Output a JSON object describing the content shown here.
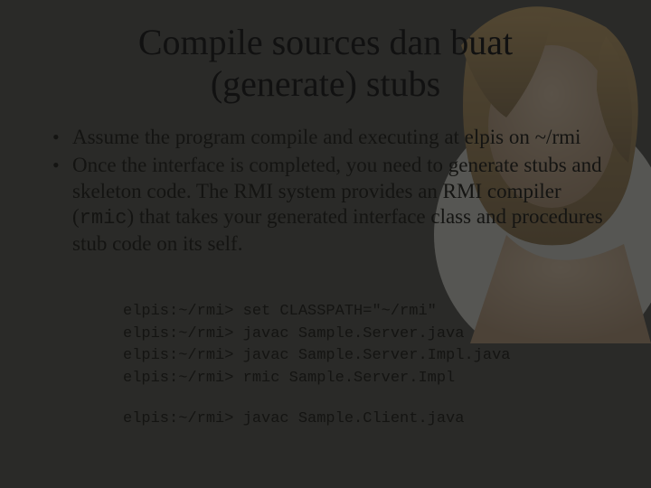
{
  "title_line1": "Compile sources dan buat",
  "title_line2": "(generate) stubs",
  "bullet1": "Assume the program compile and executing at elpis on ~/rmi",
  "bullet2_pre": "Once the interface is completed, you need to generate stubs and skeleton code. The RMI system provides an RMI compiler (",
  "bullet2_code": "rmic",
  "bullet2_post": ") that takes your generated interface class and procedures stub code on its self.",
  "code": {
    "l1": "elpis:~/rmi> set CLASSPATH=\"~/rmi\"",
    "l2": "elpis:~/rmi> javac Sample.Server.java",
    "l3": "elpis:~/rmi> javac Sample.Server.Impl.java",
    "l4": "elpis:~/rmi> rmic Sample.Server.Impl",
    "l5": "elpis:~/rmi> javac Sample.Client.java"
  }
}
